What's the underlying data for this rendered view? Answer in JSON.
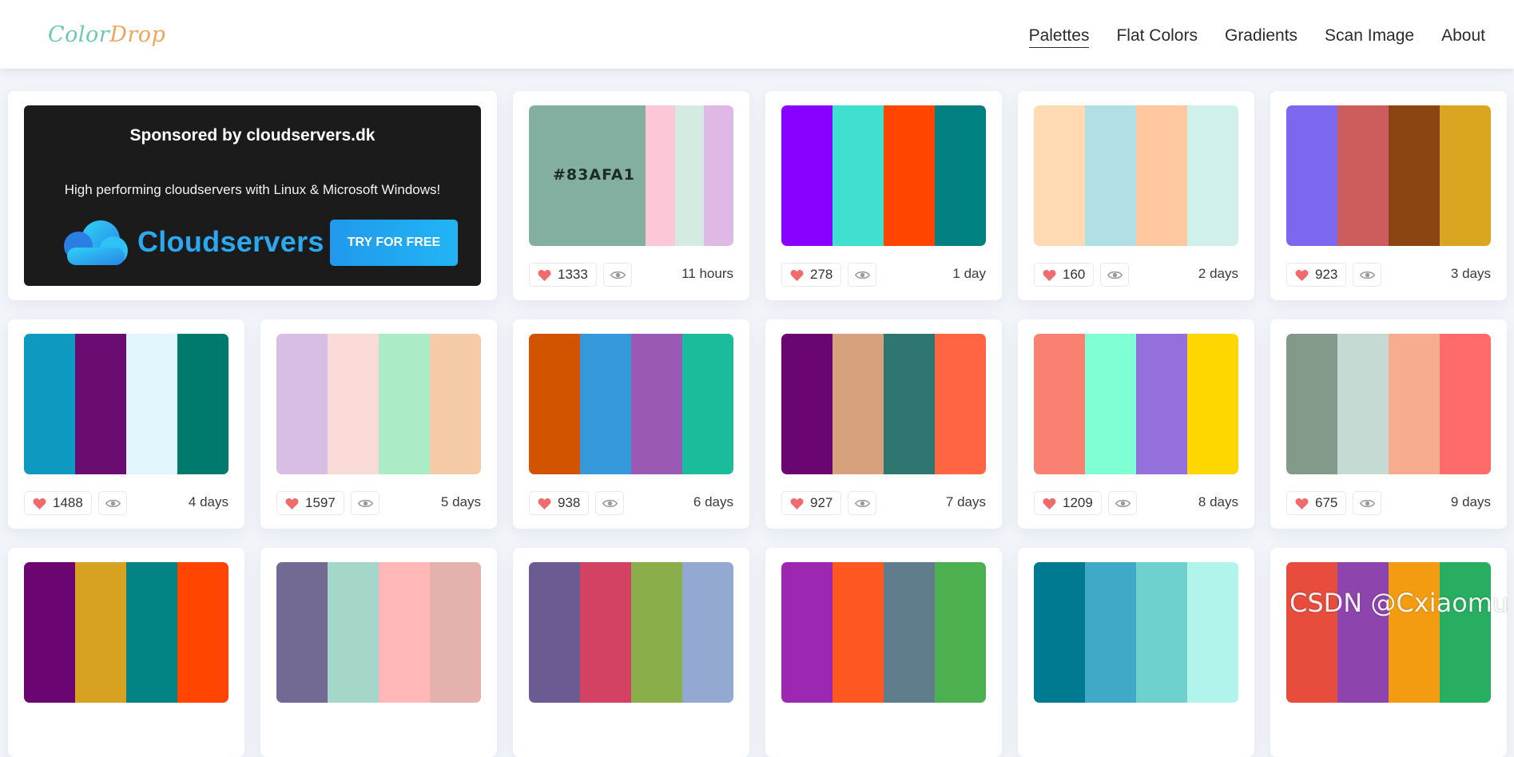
{
  "header": {
    "logo_part1": "Color",
    "logo_part2": "Drop",
    "nav": [
      "Palettes",
      "Flat Colors",
      "Gradients",
      "Scan Image",
      "About"
    ],
    "active_nav": "Palettes"
  },
  "sponsor": {
    "title": "Sponsored by cloudservers.dk",
    "description": "High performing cloudservers with Linux & Microsoft Windows!",
    "brand": "Cloudservers",
    "cta": "TRY FOR FREE"
  },
  "palettes": [
    {
      "colors": [
        "#83AFA1",
        "#FCC8D8",
        "#D4EBE1",
        "#E0B8E6"
      ],
      "hex_label": "#83AFA1",
      "likes": "1333",
      "time": "11 hours"
    },
    {
      "colors": [
        "#8800FF",
        "#40E0D0",
        "#FF4500",
        "#008080"
      ],
      "likes": "278",
      "time": "1 day"
    },
    {
      "colors": [
        "#FFDAB3",
        "#B0E0E6",
        "#FFC8A0",
        "#D0F0EB"
      ],
      "likes": "160",
      "time": "2 days"
    },
    {
      "colors": [
        "#7B68EE",
        "#CD5C5C",
        "#8B4513",
        "#DAA520"
      ],
      "likes": "923",
      "time": "3 days"
    },
    {
      "colors": [
        "#0E9AC0",
        "#6A0D73",
        "#E0F6FC",
        "#007A6C"
      ],
      "likes": "1488",
      "time": "4 days"
    },
    {
      "colors": [
        "#D8BEE5",
        "#FADBD8",
        "#ABEBC6",
        "#F5CBA7"
      ],
      "likes": "1597",
      "time": "5 days"
    },
    {
      "colors": [
        "#D35400",
        "#3498DB",
        "#9B59B6",
        "#1ABC9C"
      ],
      "likes": "938",
      "time": "6 days"
    },
    {
      "colors": [
        "#6A0572",
        "#D8A17E",
        "#2F7671",
        "#FF6542"
      ],
      "likes": "927",
      "time": "7 days"
    },
    {
      "colors": [
        "#FA8072",
        "#7FFFD4",
        "#9370DB",
        "#FFD700"
      ],
      "likes": "1209",
      "time": "8 days"
    },
    {
      "colors": [
        "#83998A",
        "#C4DAD3",
        "#F7AD8D",
        "#FF6B6B"
      ],
      "likes": "675",
      "time": "9 days"
    },
    {
      "colors": [
        "#6A0572",
        "#D7A222",
        "#038383",
        "#FF4500"
      ],
      "likes": "",
      "time": ""
    },
    {
      "colors": [
        "#736A93",
        "#A5D6CA",
        "#FFB7B7",
        "#E3B2AC"
      ],
      "likes": "",
      "time": ""
    },
    {
      "colors": [
        "#6C5B93",
        "#D44263",
        "#8AAF4A",
        "#93A9D1"
      ],
      "likes": "",
      "time": ""
    },
    {
      "colors": [
        "#9C27B0",
        "#FF5722",
        "#607D8B",
        "#4CAF50"
      ],
      "likes": "",
      "time": ""
    },
    {
      "colors": [
        "#007A91",
        "#40A9C8",
        "#6ED1CE",
        "#B0F4EC"
      ],
      "likes": "",
      "time": ""
    },
    {
      "colors": [
        "#E74C3C",
        "#8E44AD",
        "#F39C12",
        "#27AE60"
      ],
      "likes": "",
      "time": ""
    }
  ],
  "watermark": "CSDN @Cxiaomu"
}
